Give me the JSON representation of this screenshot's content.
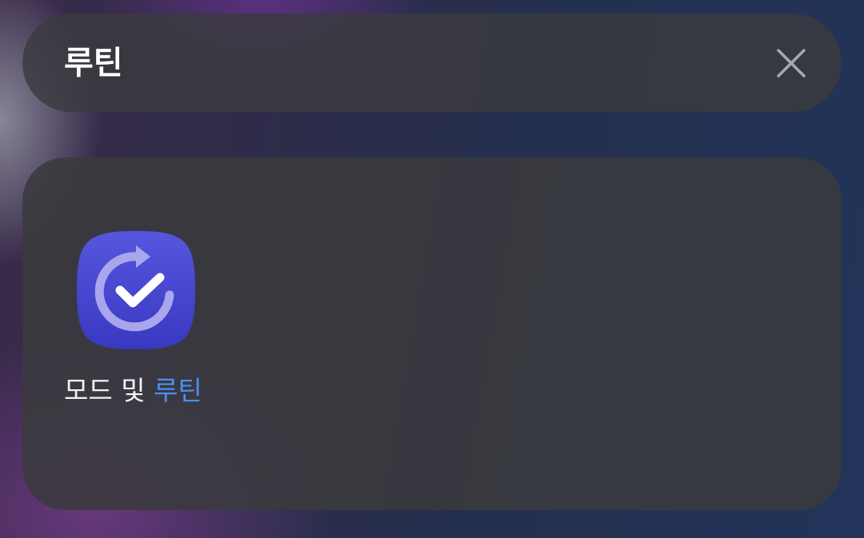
{
  "search": {
    "query": "루틴",
    "clear_icon": "close-icon"
  },
  "results": {
    "apps": [
      {
        "label_prefix": "모드 및 ",
        "label_match": "루틴",
        "icon": "modes-and-routines-icon",
        "icon_color": "#4b4bd6"
      }
    ]
  },
  "colors": {
    "accent_match": "#4c8ff0",
    "card_bg": "#3a3a3e"
  }
}
